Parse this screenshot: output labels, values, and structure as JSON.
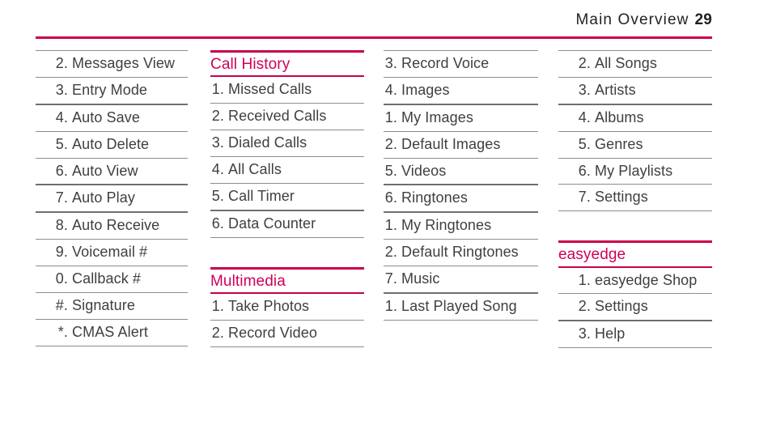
{
  "header": {
    "title": "Main Overview",
    "page_number": "29"
  },
  "colors": {
    "accent": "#c8004b",
    "heading_text": "#d1005a",
    "body_text": "#3f3f3f",
    "rule": "#8d8d8d",
    "rule_strong": "#6f6f6f"
  },
  "columns": [
    {
      "id": "column-1",
      "sections": [
        {
          "id": "messaging-settings-continued",
          "heading": null,
          "items": [
            {
              "num": "2.",
              "label": "Messages View",
              "indent": 1,
              "thick": false
            },
            {
              "num": "3.",
              "label": "Entry Mode",
              "indent": 1,
              "thick": true
            },
            {
              "num": "4.",
              "label": "Auto Save",
              "indent": 1,
              "thick": false
            },
            {
              "num": "5.",
              "label": "Auto Delete",
              "indent": 1,
              "thick": false
            },
            {
              "num": "6.",
              "label": "Auto View",
              "indent": 1,
              "thick": true
            },
            {
              "num": "7.",
              "label": "Auto Play",
              "indent": 1,
              "thick": true
            },
            {
              "num": "8.",
              "label": "Auto Receive",
              "indent": 1,
              "thick": false
            },
            {
              "num": "9.",
              "label": "Voicemail #",
              "indent": 1,
              "thick": false
            },
            {
              "num": "0.",
              "label": "Callback #",
              "indent": 1,
              "thick": false
            },
            {
              "num": "#.",
              "label": "Signature",
              "indent": 1,
              "thick": false
            },
            {
              "num": "*.",
              "label": "CMAS Alert",
              "indent": 1,
              "thick": false
            }
          ]
        }
      ]
    },
    {
      "id": "column-2",
      "sections": [
        {
          "id": "call-history",
          "heading": "Call History",
          "items": [
            {
              "num": "1.",
              "label": "Missed Calls",
              "indent": 0,
              "thick": false
            },
            {
              "num": "2.",
              "label": "Received Calls",
              "indent": 0,
              "thick": false
            },
            {
              "num": "3.",
              "label": "Dialed Calls",
              "indent": 0,
              "thick": false
            },
            {
              "num": "4.",
              "label": "All Calls",
              "indent": 0,
              "thick": false
            },
            {
              "num": "5.",
              "label": "Call Timer",
              "indent": 0,
              "thick": true
            },
            {
              "num": "6.",
              "label": "Data Counter",
              "indent": 0,
              "thick": false
            }
          ]
        },
        {
          "id": "multimedia",
          "heading": "Multimedia",
          "items": [
            {
              "num": "1.",
              "label": "Take Photos",
              "indent": 0,
              "thick": false
            },
            {
              "num": "2.",
              "label": "Record Video",
              "indent": 0,
              "thick": false
            }
          ]
        }
      ]
    },
    {
      "id": "column-3",
      "sections": [
        {
          "id": "multimedia-continued",
          "heading": null,
          "items": [
            {
              "num": "3.",
              "label": "Record Voice",
              "indent": 0,
              "thick": false
            },
            {
              "num": "4.",
              "label": "Images",
              "indent": 0,
              "thick": true
            },
            {
              "num": "1.",
              "label": "My Images",
              "indent": 2,
              "thick": false
            },
            {
              "num": "2.",
              "label": "Default Images",
              "indent": 2,
              "thick": false
            },
            {
              "num": "5.",
              "label": "Videos",
              "indent": 0,
              "thick": true
            },
            {
              "num": "6.",
              "label": "Ringtones",
              "indent": 0,
              "thick": true
            },
            {
              "num": "1.",
              "label": "My Ringtones",
              "indent": 2,
              "thick": false
            },
            {
              "num": "2.",
              "label": "Default Ringtones",
              "indent": 2,
              "thick": false
            },
            {
              "num": "7.",
              "label": "Music",
              "indent": 0,
              "thick": true
            },
            {
              "num": "1.",
              "label": "Last Played Song",
              "indent": 2,
              "thick": false
            }
          ]
        }
      ]
    },
    {
      "id": "column-4",
      "sections": [
        {
          "id": "music-continued",
          "heading": null,
          "items": [
            {
              "num": "2.",
              "label": "All Songs",
              "indent": 1,
              "thick": false
            },
            {
              "num": "3.",
              "label": "Artists",
              "indent": 1,
              "thick": true
            },
            {
              "num": "4.",
              "label": "Albums",
              "indent": 1,
              "thick": false
            },
            {
              "num": "5.",
              "label": "Genres",
              "indent": 1,
              "thick": false
            },
            {
              "num": "6.",
              "label": "My Playlists",
              "indent": 1,
              "thick": false
            },
            {
              "num": "7.",
              "label": "Settings",
              "indent": 1,
              "thick": false
            }
          ]
        },
        {
          "id": "easyedge",
          "heading": "easyedge",
          "items": [
            {
              "num": "1.",
              "label": "easyedge Shop",
              "indent": 0,
              "thick": false
            },
            {
              "num": "2.",
              "label": "Settings",
              "indent": 0,
              "thick": true
            },
            {
              "num": "3.",
              "label": "Help",
              "indent": 0,
              "thick": false
            }
          ]
        }
      ]
    }
  ]
}
